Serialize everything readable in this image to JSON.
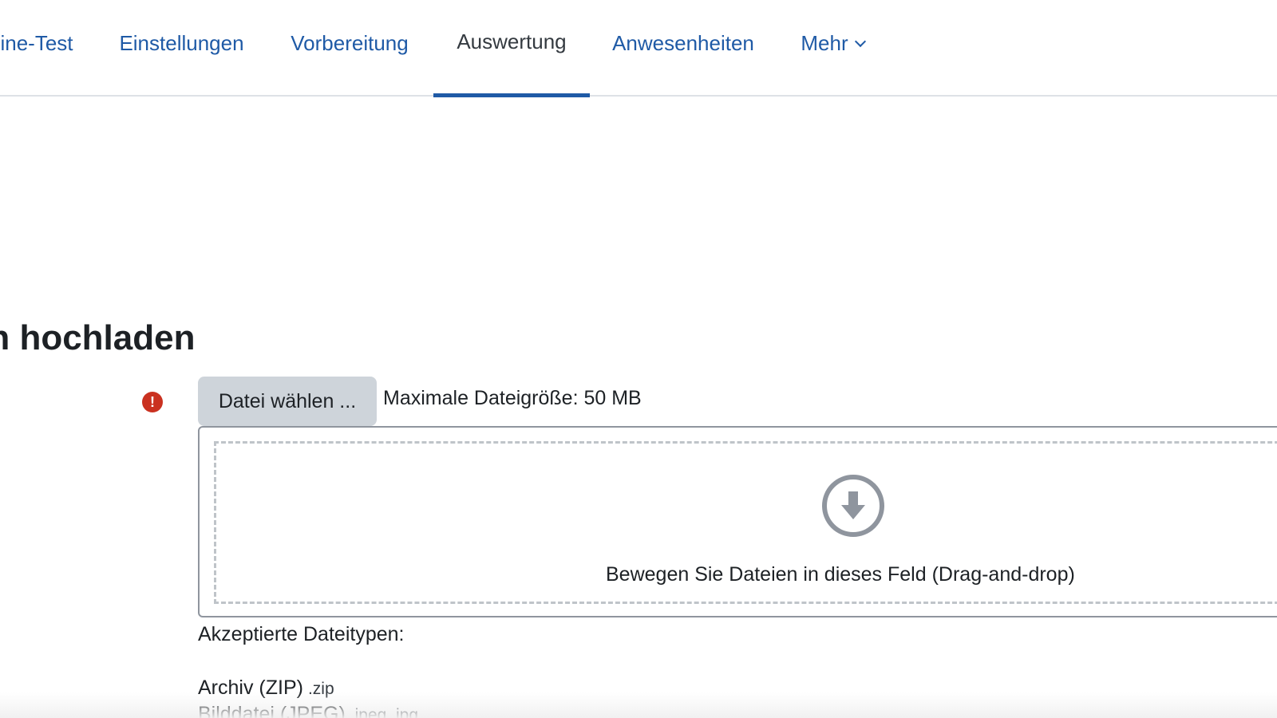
{
  "nav": {
    "tabs": [
      {
        "label": "ine-Test",
        "active": false
      },
      {
        "label": "Einstellungen",
        "active": false
      },
      {
        "label": "Vorbereitung",
        "active": false
      },
      {
        "label": "Auswertung",
        "active": true
      },
      {
        "label": "Anwesenheiten",
        "active": false
      },
      {
        "label": "Mehr",
        "active": false,
        "has_dropdown": true
      }
    ]
  },
  "main": {
    "heading": "gen hochladen",
    "required_icon": "exclamation-circle-icon",
    "choose_button_label": "Datei wählen ...",
    "max_size_text": "Maximale Dateigröße: 50 MB",
    "dropzone_icon": "arrow-circle-down-icon",
    "dropzone_text": "Bewegen Sie Dateien in dieses Feld (Drag-and-drop)",
    "accepted_label": "Akzeptierte Dateitypen:",
    "file_types": [
      {
        "name": "Archiv (ZIP)",
        "ext": ".zip"
      },
      {
        "name": "Bilddatei (JPEG)",
        "ext": ".jpeg .jpg"
      }
    ]
  },
  "colors": {
    "link": "#1f5aa6",
    "active_text": "#343a40",
    "error": "#ca3120",
    "button_bg": "#ced4da"
  }
}
